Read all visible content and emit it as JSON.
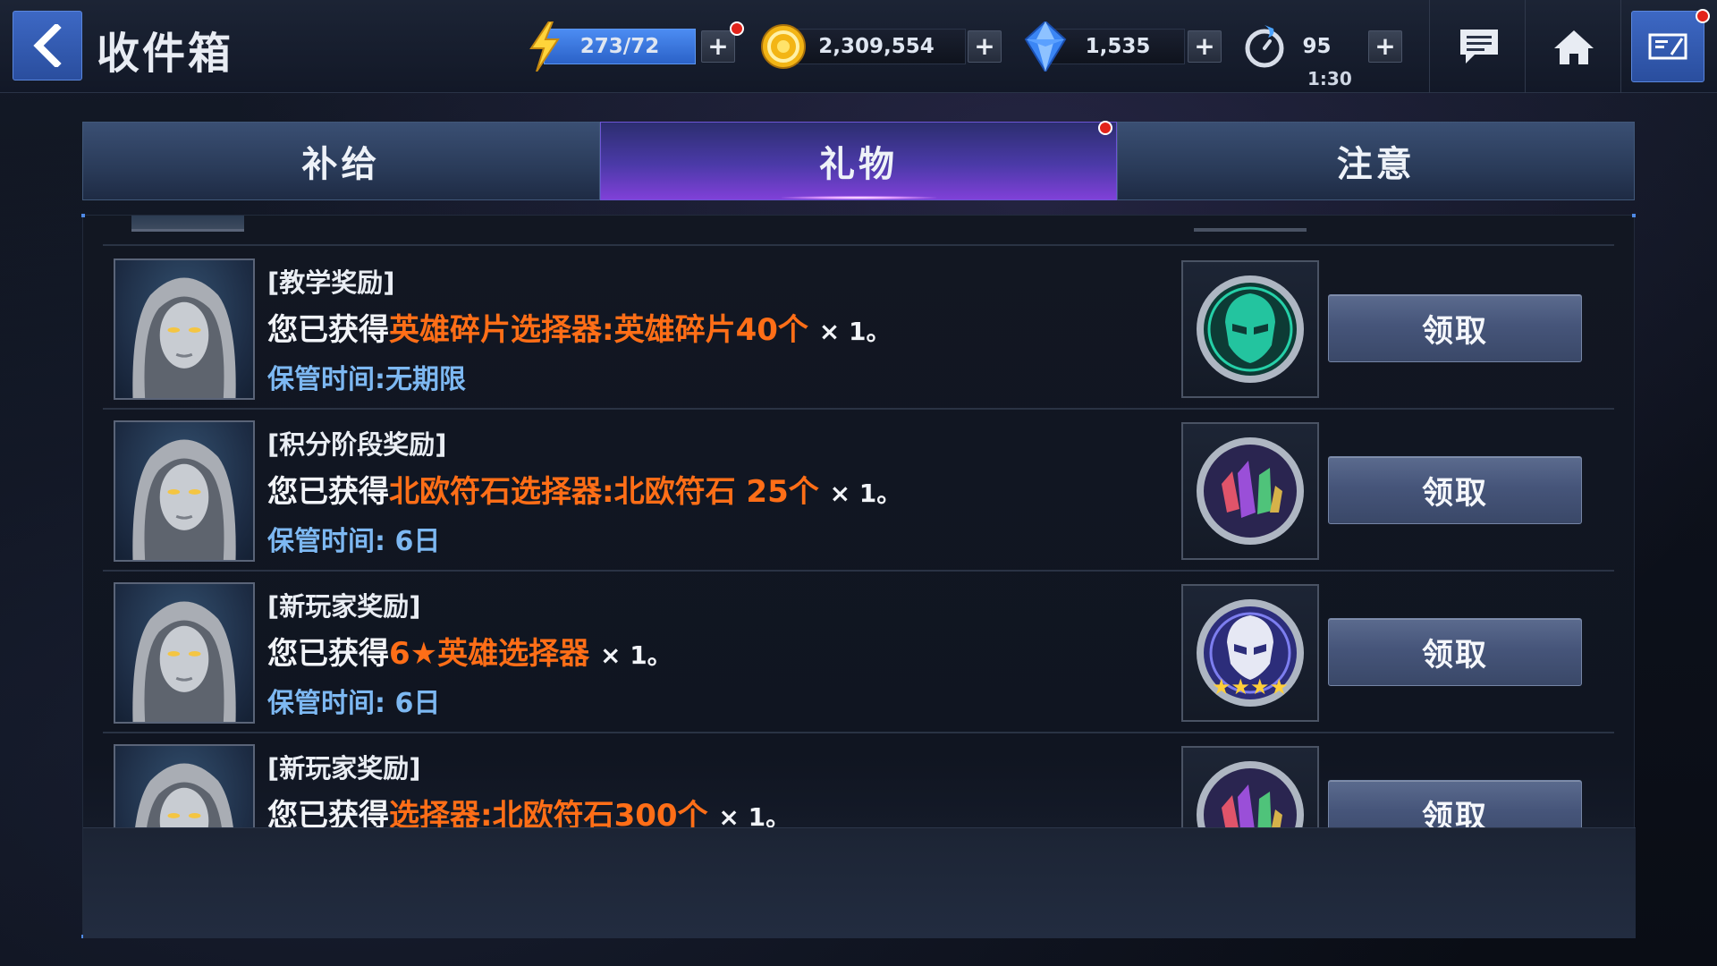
{
  "window": {
    "title": "收件箱"
  },
  "resources": {
    "energy": {
      "value": "273/72",
      "icon": "lightning-icon"
    },
    "gold": {
      "value": "2,309,554",
      "icon": "gold-coin-icon"
    },
    "crystals": {
      "value": "1,535",
      "icon": "blue-crystal-icon"
    },
    "timer": {
      "value": "95",
      "sub": "1:30",
      "icon": "stopwatch-icon"
    }
  },
  "header_icons": [
    "chat-icon",
    "home-icon",
    "menu-icon"
  ],
  "tabs": [
    {
      "label": "补给",
      "active": false
    },
    {
      "label": "礼物",
      "active": true
    },
    {
      "label": "注意",
      "active": false
    }
  ],
  "mails": [
    {
      "tag": "[教学奖励]",
      "prefix": "您已获得",
      "item": "英雄碎片选择器:英雄碎片40个",
      "qty": "× 1。",
      "expiry": "保管时间:无期限",
      "icon": "hero-shard-selector-icon",
      "claim": "领取"
    },
    {
      "tag": "[积分阶段奖励]",
      "prefix": "您已获得",
      "item": "北欧符石选择器:北欧符石 25个",
      "qty": "× 1。",
      "expiry": "保管时间: 6日",
      "icon": "norn-stone-selector-icon",
      "claim": "领取"
    },
    {
      "tag": "[新玩家奖励]",
      "prefix": "您已获得",
      "item": "6★英雄选择器",
      "qty": "× 1。",
      "expiry": "保管时间: 6日",
      "icon": "six-star-hero-selector-icon",
      "claim": "领取"
    },
    {
      "tag": "[新玩家奖励]",
      "prefix": "您已获得",
      "item": "选择器:北欧符石300个",
      "qty": "× 1。",
      "expiry": "",
      "icon": "norn-stone-selector-icon",
      "claim": "领取"
    }
  ],
  "colors": {
    "highlight": "#ff6e17",
    "expiry": "#7db8f2",
    "active_tab": "#6a46c8",
    "accent_blue": "#3d68c4"
  }
}
